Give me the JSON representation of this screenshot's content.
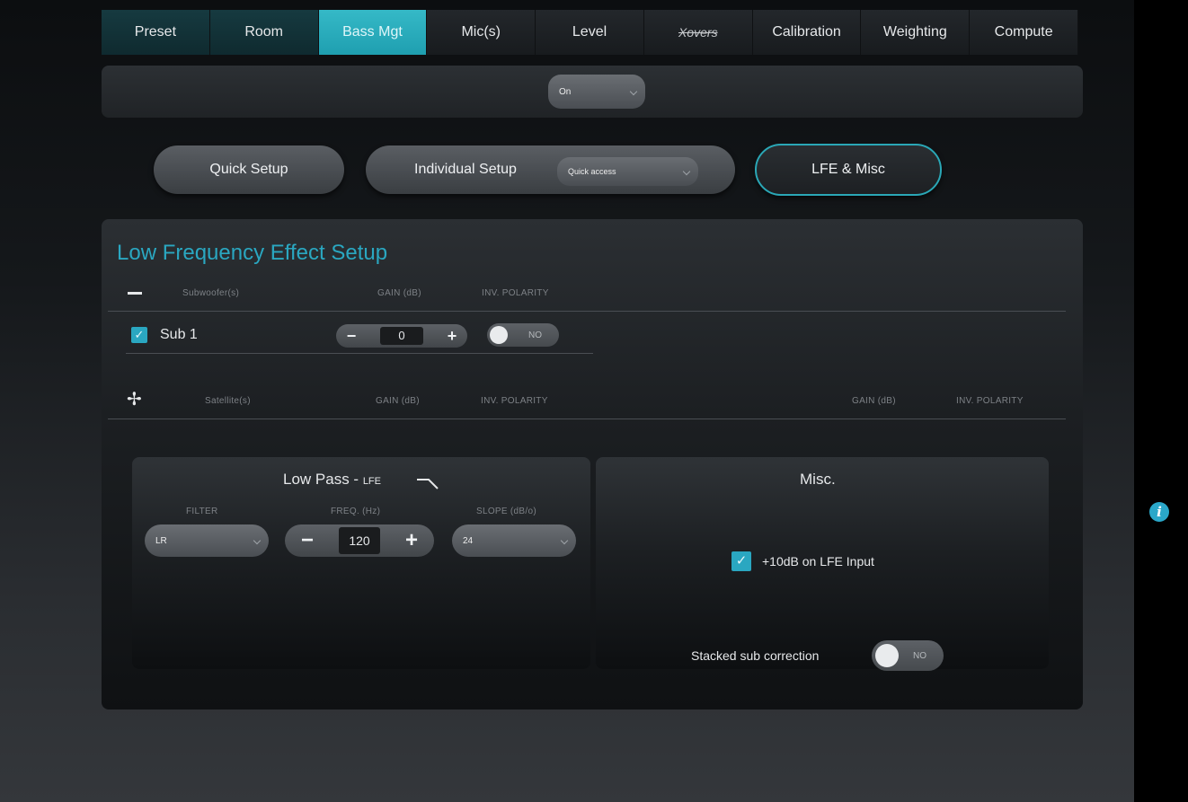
{
  "tabs": [
    {
      "label": "Preset"
    },
    {
      "label": "Room"
    },
    {
      "label": "Bass Mgt"
    },
    {
      "label": "Mic(s)"
    },
    {
      "label": "Level"
    },
    {
      "label": "Xovers"
    },
    {
      "label": "Calibration"
    },
    {
      "label": "Weighting"
    },
    {
      "label": "Compute"
    }
  ],
  "active_tab": "Bass Mgt",
  "topbar": {
    "mode_value": "On"
  },
  "setup_buttons": {
    "quick": "Quick Setup",
    "individual": "Individual Setup",
    "quick_access": "Quick access",
    "lfe": "LFE & Misc"
  },
  "lfe_setup": {
    "title": "Low Frequency Effect Setup",
    "sub_headers": {
      "name": "Subwoofer(s)",
      "gain": "GAIN (dB)",
      "polarity": "INV. POLARITY"
    },
    "subs": [
      {
        "name": "Sub 1",
        "checked": true,
        "gain": "0",
        "polarity": "NO"
      }
    ],
    "sat_headers": {
      "name": "Satellite(s)",
      "gain": "GAIN (dB)",
      "polarity": "INV. POLARITY",
      "gain2": "GAIN (dB)",
      "polarity2": "INV. POLARITY"
    }
  },
  "low_pass": {
    "title": "Low Pass - ",
    "title_small": "LFE",
    "filter_label": "FILTER",
    "freq_label": "FREQ. (Hz)",
    "slope_label": "SLOPE (dB/o)",
    "filter_value": "LR",
    "freq_value": "120",
    "slope_value": "24"
  },
  "misc": {
    "title": "Misc.",
    "lfe_input_label": "+10dB on LFE Input",
    "lfe_input_checked": true,
    "stacked_label": "Stacked sub correction",
    "stacked_value": "NO"
  },
  "colors": {
    "accent": "#2aa7c1",
    "active_tab": "#2fb3c3"
  },
  "icons": {
    "info": "info-icon",
    "minus": "collapse-icon",
    "satellite": "expand-icon"
  }
}
